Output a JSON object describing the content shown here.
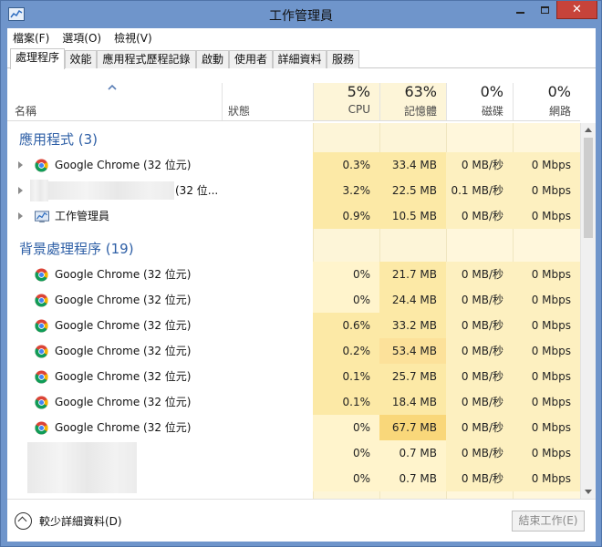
{
  "window": {
    "title": "工作管理員"
  },
  "menu": [
    "檔案(F)",
    "選項(O)",
    "檢視(V)"
  ],
  "tabs": [
    "處理程序",
    "效能",
    "應用程式歷程記錄",
    "啟動",
    "使用者",
    "詳細資料",
    "服務"
  ],
  "columns": {
    "name": "名稱",
    "status": "狀態",
    "cpu": {
      "percent": "5%",
      "label": "CPU"
    },
    "memory": {
      "percent": "63%",
      "label": "記憶體"
    },
    "disk": {
      "percent": "0%",
      "label": "磁碟"
    },
    "network": {
      "percent": "0%",
      "label": "網路"
    }
  },
  "groups": {
    "apps": {
      "title": "應用程式 (3)",
      "rows": [
        {
          "name": "Google Chrome (32 位元)",
          "cpu": "0.3%",
          "memory": "33.4 MB",
          "disk": "0 MB/秒",
          "network": "0 Mbps",
          "icon": "chrome-icon"
        },
        {
          "name": "(32 位...",
          "cpu": "3.2%",
          "memory": "22.5 MB",
          "disk": "0.1 MB/秒",
          "network": "0 Mbps",
          "icon": "blurred-app-icon"
        },
        {
          "name": "工作管理員",
          "cpu": "0.9%",
          "memory": "10.5 MB",
          "disk": "0 MB/秒",
          "network": "0 Mbps",
          "icon": "task-manager-icon"
        }
      ]
    },
    "background": {
      "title": "背景處理程序 (19)",
      "rows": [
        {
          "name": "Google Chrome (32 位元)",
          "cpu": "0%",
          "memory": "21.7 MB",
          "disk": "0 MB/秒",
          "network": "0 Mbps"
        },
        {
          "name": "Google Chrome (32 位元)",
          "cpu": "0%",
          "memory": "24.4 MB",
          "disk": "0 MB/秒",
          "network": "0 Mbps"
        },
        {
          "name": "Google Chrome (32 位元)",
          "cpu": "0.6%",
          "memory": "33.2 MB",
          "disk": "0 MB/秒",
          "network": "0 Mbps"
        },
        {
          "name": "Google Chrome (32 位元)",
          "cpu": "0.2%",
          "memory": "53.4 MB",
          "disk": "0 MB/秒",
          "network": "0 Mbps"
        },
        {
          "name": "Google Chrome (32 位元)",
          "cpu": "0.1%",
          "memory": "25.7 MB",
          "disk": "0 MB/秒",
          "network": "0 Mbps"
        },
        {
          "name": "Google Chrome (32 位元)",
          "cpu": "0.1%",
          "memory": "18.4 MB",
          "disk": "0 MB/秒",
          "network": "0 Mbps"
        },
        {
          "name": "Google Chrome (32 位元)",
          "cpu": "0%",
          "memory": "67.7 MB",
          "disk": "0 MB/秒",
          "network": "0 Mbps"
        },
        {
          "name": "",
          "cpu": "0%",
          "memory": "0.7 MB",
          "disk": "0 MB/秒",
          "network": "0 Mbps"
        },
        {
          "name": "",
          "cpu": "0%",
          "memory": "0.7 MB",
          "disk": "0 MB/秒",
          "network": "0 Mbps"
        }
      ]
    }
  },
  "footer": {
    "fewer_details": "較少詳細資料(D)",
    "end_task": "結束工作(E)"
  },
  "colors": {
    "heat_light": "#fff4c4",
    "heat_medium": "#fde9a2",
    "heat_strong": "#f9dc7e",
    "header_col": "#fdf5d8",
    "group_title": "#2e5fa6",
    "titlebar": "#6f95cb",
    "close_button": "#c7433a"
  }
}
